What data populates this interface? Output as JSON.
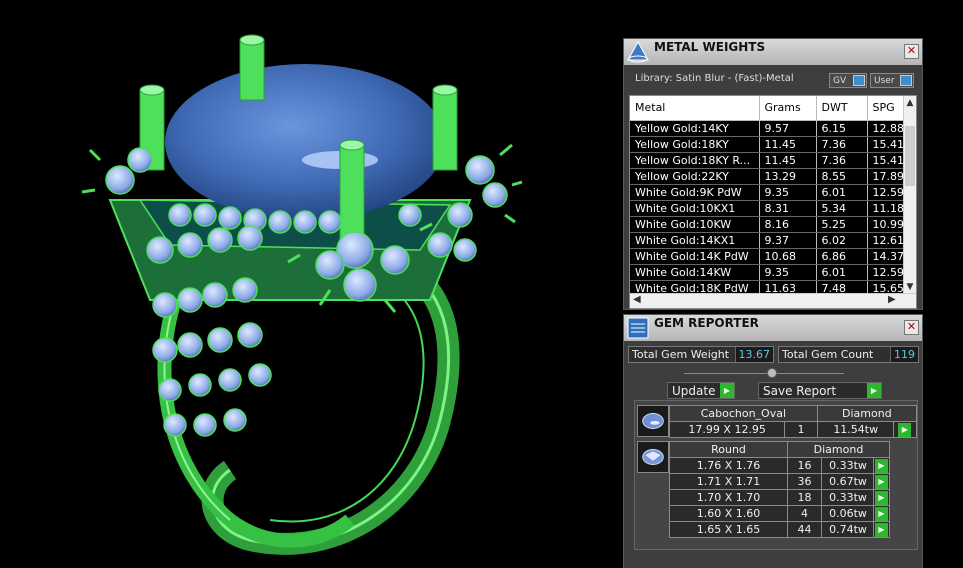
{
  "metal_panel": {
    "title": "METAL WEIGHTS",
    "close_label": "✕",
    "library": "Library: Satin Blur - (Fast)-Metal",
    "toggles": {
      "gv": "GV",
      "user": "User"
    },
    "columns": [
      "Metal",
      "Grams",
      "DWT",
      "SPG"
    ],
    "rows": [
      [
        "Yellow Gold:14KY",
        "9.57",
        "6.15",
        "12.88"
      ],
      [
        "Yellow Gold:18KY",
        "11.45",
        "7.36",
        "15.41"
      ],
      [
        "Yellow Gold:18KY R...",
        "11.45",
        "7.36",
        "15.41"
      ],
      [
        "Yellow Gold:22KY",
        "13.29",
        "8.55",
        "17.89"
      ],
      [
        "White Gold:9K PdW",
        "9.35",
        "6.01",
        "12.59"
      ],
      [
        "White Gold:10KX1",
        "8.31",
        "5.34",
        "11.18"
      ],
      [
        "White Gold:10KW",
        "8.16",
        "5.25",
        "10.99"
      ],
      [
        "White Gold:14KX1",
        "9.37",
        "6.02",
        "12.61"
      ],
      [
        "White Gold:14K PdW",
        "10.68",
        "6.86",
        "14.37"
      ],
      [
        "White Gold:14KW",
        "9.35",
        "6.01",
        "12.59"
      ],
      [
        "White Gold:18K PdW",
        "11.63",
        "7.48",
        "15.65"
      ]
    ]
  },
  "gem_panel": {
    "title": "GEM REPORTER",
    "close_label": "✕",
    "total_weight_label": "Total Gem Weight",
    "total_weight": "13.67",
    "total_count_label": "Total Gem Count",
    "total_count": "119",
    "update_label": "Update",
    "save_label": "Save Report",
    "groups": [
      {
        "shape": "Cabochon_Oval",
        "material": "Diamond",
        "rows": [
          [
            "17.99 X 12.95",
            "1",
            "11.54tw"
          ]
        ]
      },
      {
        "shape": "Round",
        "material": "Diamond",
        "rows": [
          [
            "1.76 X 1.76",
            "16",
            "0.33tw"
          ],
          [
            "1.71 X 1.71",
            "36",
            "0.67tw"
          ],
          [
            "1.70 X 1.70",
            "18",
            "0.33tw"
          ],
          [
            "1.60 X 1.60",
            "4",
            "0.06tw"
          ],
          [
            "1.65 X 1.65",
            "44",
            "0.74tw"
          ]
        ]
      }
    ]
  },
  "colors": {
    "metal": "#4ee05a",
    "stone": "#3f6fb8",
    "accent": "#5ec8e6",
    "go_button": "#2eb62e"
  }
}
